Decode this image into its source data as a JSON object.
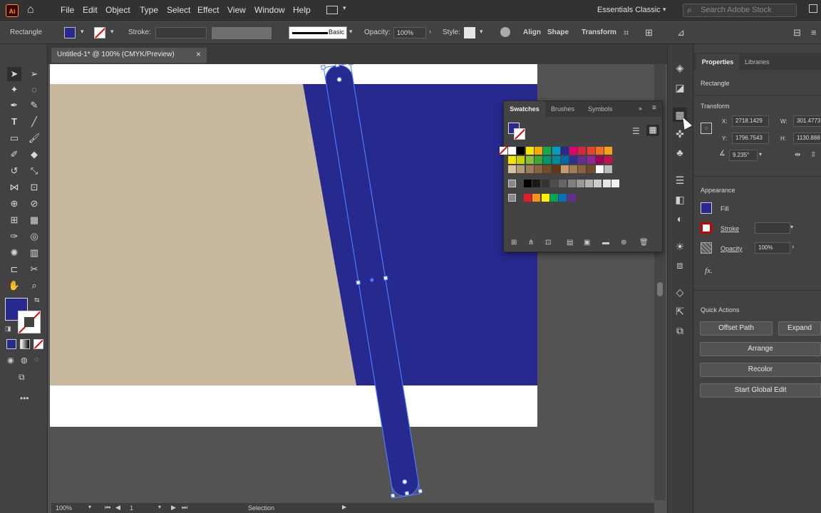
{
  "menu": {
    "app_logo": "Ai",
    "items": [
      "File",
      "Edit",
      "Object",
      "Type",
      "Select",
      "Effect",
      "View",
      "Window",
      "Help"
    ],
    "workspace": "Essentials Classic",
    "search_placeholder": "Search Adobe Stock"
  },
  "control_bar": {
    "object_type": "Rectangle",
    "stroke_label": "Stroke:",
    "brush_label": "Basic",
    "opacity_label": "Opacity:",
    "opacity_value": "100%",
    "style_label": "Style:",
    "align_label": "Align",
    "shape_label": "Shape",
    "transform_label": "Transform"
  },
  "document": {
    "tab_title": "Untitled-1* @ 100% (CMYK/Preview)",
    "colors": {
      "beige": "#c8b89d",
      "navy": "#262a8f",
      "artboard": "#ffffff"
    }
  },
  "status_bar": {
    "zoom": "100%",
    "artboard_number": "1",
    "tool_name": "Selection"
  },
  "swatches_panel": {
    "tabs": [
      "Swatches",
      "Brushes",
      "Symbols"
    ],
    "swatch_rows": [
      [
        "#ffffff",
        "#000000",
        "#f5e800",
        "#f9a800",
        "#17a84a",
        "#00a0c6",
        "#262a8f",
        "#e4006d",
        "#d7263d",
        "#e8442c",
        "#f37021",
        "#f7a11a"
      ],
      [
        "#f2e600",
        "#c8d400",
        "#8bbd3c",
        "#3aa935",
        "#00966c",
        "#008e9b",
        "#0069a8",
        "#2e3192",
        "#662d91",
        "#92278f",
        "#9e005d",
        "#c1124b"
      ],
      [
        "#d8c2a0",
        "#b49a78",
        "#a07d57",
        "#8b6239",
        "#754c24",
        "#603913",
        "#c69c6d",
        "#a67c52",
        "#8c6239",
        "#754c29",
        "#ffffff",
        "#bbbbbb"
      ],
      [
        "#000000",
        "#1a1a1a",
        "#333333",
        "#4d4d4d",
        "#666666",
        "#808080",
        "#999999",
        "#b3b3b3",
        "#cccccc",
        "#e6e6e6",
        "#f2f2f2"
      ],
      [
        "#e41e26",
        "#f7941d",
        "#fff200",
        "#00a651",
        "#0072bc",
        "#662d91"
      ]
    ]
  },
  "properties_panel": {
    "tabs": [
      "Properties",
      "Libraries"
    ],
    "selection_type": "Rectangle",
    "transform_title": "Transform",
    "x_label": "X:",
    "x_value": "2718.1429",
    "y_label": "Y:",
    "y_value": "1796.7543",
    "w_label": "W:",
    "w_value": "301.4773",
    "h_label": "H:",
    "h_value": "1130.888",
    "angle_value": "9.235°",
    "appearance_title": "Appearance",
    "fill_label": "Fill",
    "stroke_label": "Stroke",
    "opacity_label": "Opacity",
    "opacity_value": "100%",
    "fx_label": "fx.",
    "quick_actions_title": "Quick Actions",
    "offset_path_label": "Offset Path",
    "expand_label": "Expand",
    "arrange_label": "Arrange",
    "recolor_label": "Recolor",
    "global_edit_label": "Start Global Edit"
  }
}
